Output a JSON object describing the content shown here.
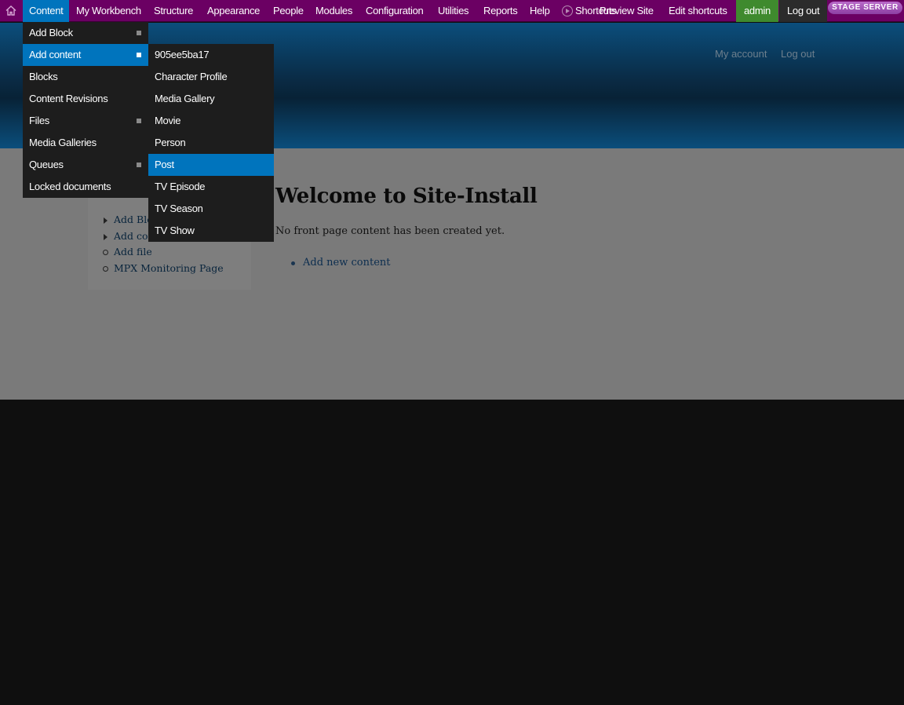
{
  "toolbar": {
    "items": [
      {
        "label": "Content"
      },
      {
        "label": "My Workbench"
      },
      {
        "label": "Structure"
      },
      {
        "label": "Appearance"
      },
      {
        "label": "People"
      },
      {
        "label": "Modules"
      },
      {
        "label": "Configuration"
      },
      {
        "label": "Utilities"
      },
      {
        "label": "Reports"
      },
      {
        "label": "Help"
      }
    ],
    "shortcuts": "Shortcuts",
    "preview_site": "Preview Site",
    "edit_shortcuts": "Edit shortcuts",
    "admin": "admin",
    "logout": "Log out",
    "stage": "STAGE SERVER",
    "home_icon": "home-icon"
  },
  "header": {
    "my_account": "My account",
    "log_out": "Log out"
  },
  "content_menu": {
    "items": [
      {
        "label": "Add Block",
        "has_sub": true
      },
      {
        "label": "Add content",
        "has_sub": true,
        "highlighted": true
      },
      {
        "label": "Blocks"
      },
      {
        "label": "Content Revisions"
      },
      {
        "label": "Files",
        "has_sub": true
      },
      {
        "label": "Media Galleries"
      },
      {
        "label": "Queues",
        "has_sub": true
      },
      {
        "label": "Locked documents"
      }
    ]
  },
  "add_content_menu": {
    "items": [
      {
        "label": "905ee5ba17"
      },
      {
        "label": "Character Profile"
      },
      {
        "label": "Media Gallery"
      },
      {
        "label": "Movie"
      },
      {
        "label": "Person"
      },
      {
        "label": "Post",
        "highlighted": true
      },
      {
        "label": "TV Episode"
      },
      {
        "label": "TV Season"
      },
      {
        "label": "TV Show"
      }
    ]
  },
  "sidebar": {
    "links": [
      {
        "label": "Add Block"
      },
      {
        "label": "Add content"
      },
      {
        "label": "Add file"
      },
      {
        "label": "MPX Monitoring Page"
      }
    ]
  },
  "main": {
    "title": "Welcome to Site-Install",
    "message": "No front page content has been created yet.",
    "add_new": "Add new content"
  },
  "colors": {
    "toolbar": "#6b0063",
    "active": "#0074bd",
    "admin": "#3f8a2e",
    "menu": "#1d1d1d"
  }
}
